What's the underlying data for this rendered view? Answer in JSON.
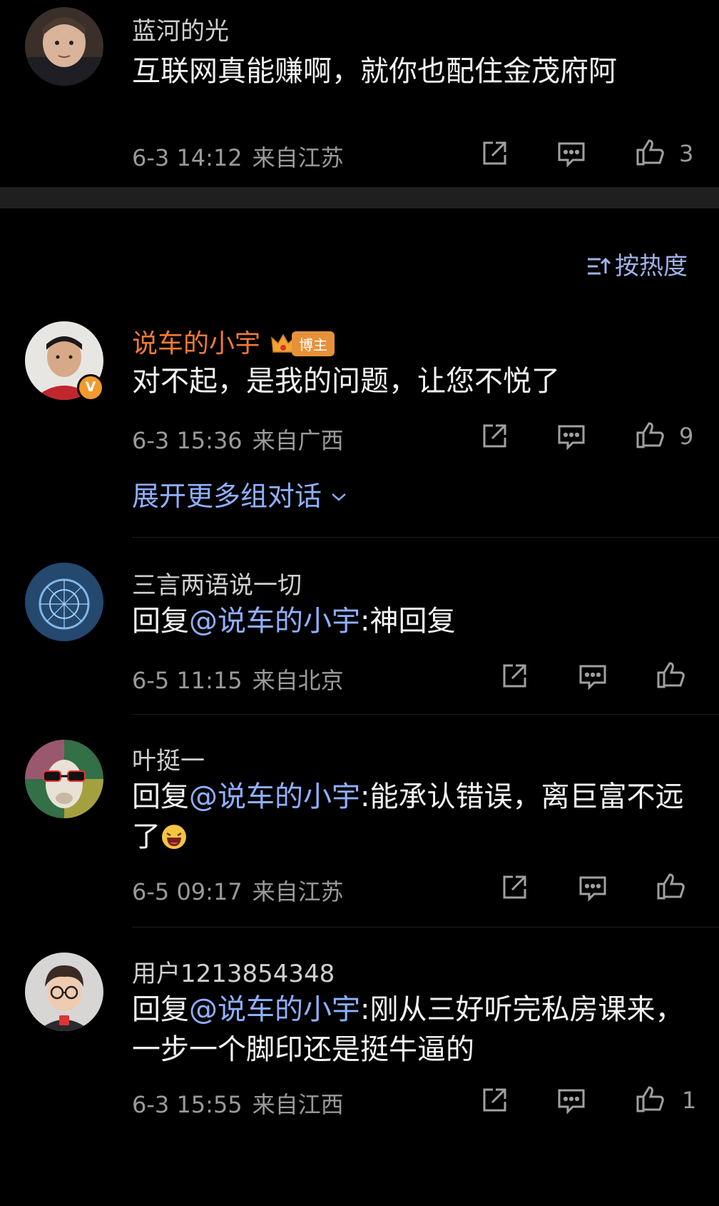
{
  "sort_label": "按热度",
  "expand_label": "展开更多组对话",
  "comments": [
    {
      "username": "蓝河的光",
      "text": "互联网真能赚啊，就你也配住金茂府阿",
      "time": "6-3 14:12",
      "location": "来自江苏",
      "likes": "3"
    },
    {
      "username": "说车的小宇",
      "badge": "博主",
      "text": "对不起，是我的问题，让您不悦了",
      "time": "6-3 15:36",
      "location": "来自广西",
      "likes": "9"
    },
    {
      "username": "三言两语说一切",
      "reply_prefix": "回复",
      "mention": "@说车的小宇",
      "text": ":神回复",
      "time": "6-5 11:15",
      "location": "来自北京"
    },
    {
      "username": "叶挺一",
      "reply_prefix": "回复",
      "mention": "@说车的小宇",
      "text": ":能承认错误，离巨富不远了",
      "time": "6-5 09:17",
      "location": "来自江苏"
    },
    {
      "username": "用户1213854348",
      "reply_prefix": "回复",
      "mention": "@说车的小宇",
      "text": ":刚从三好听完私房课来，一步一个脚印还是挺牛逼的",
      "time": "6-3 15:55",
      "location": "来自江西",
      "likes": "1"
    }
  ],
  "colors": {
    "background": "#000000",
    "divider": "#1f1f1f",
    "author_name": "#f07a35",
    "mention": "#8fb0ff",
    "meta": "#9a9a9a"
  },
  "icons": [
    "share-icon",
    "comment-icon",
    "like-icon",
    "sort-icon",
    "chevron-down-icon",
    "crown-icon",
    "verified-icon",
    "laughing-emoji-icon"
  ]
}
